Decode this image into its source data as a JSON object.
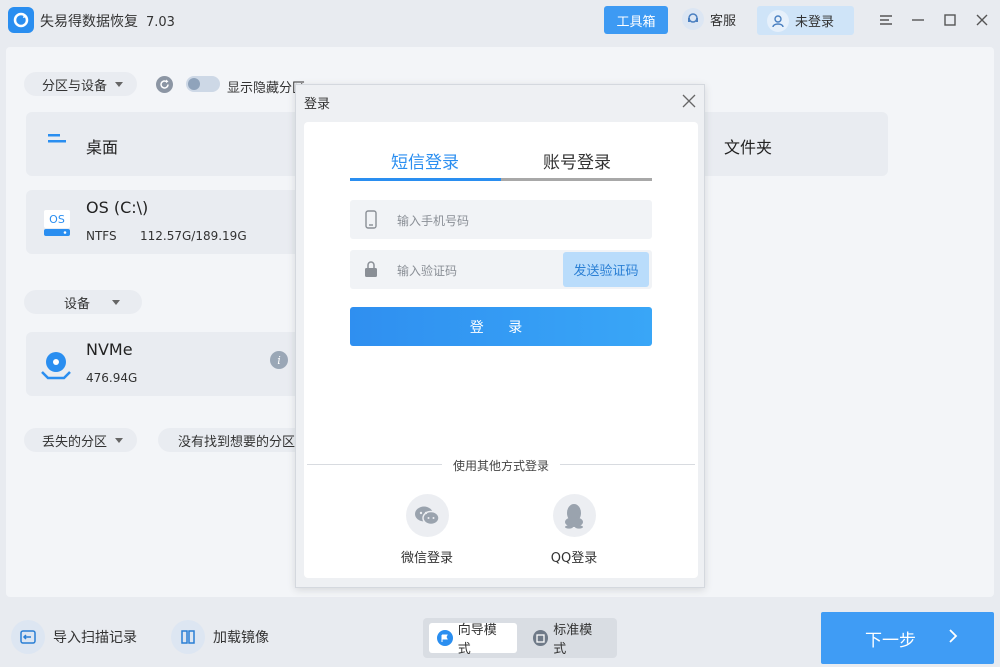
{
  "titlebar": {
    "app_name": "失易得数据恢复",
    "version": "7.03",
    "toolbox_label": "工具箱",
    "service_label": "客服",
    "login_status": "未登录"
  },
  "main": {
    "partition_dropdown": "分区与设备",
    "show_hidden_label": "显示隐藏分区",
    "desktop_label": "桌面",
    "folder_label": "文件夹",
    "os_drive": {
      "badge": "OS",
      "name": "OS (C:\\)",
      "fs": "NTFS",
      "usage": "112.57G/189.19G"
    },
    "device_dropdown": "设备",
    "nvme": {
      "name": "NVMe",
      "size": "476.94G"
    },
    "lost_partition_dropdown": "丢失的分区",
    "not_found_label": "没有找到想要的分区"
  },
  "bottom": {
    "import_scan": "导入扫描记录",
    "load_image": "加载镜像",
    "guide_mode": "向导模式",
    "standard_mode": "标准模式",
    "next_step": "下一步"
  },
  "modal": {
    "title": "登录",
    "tabs": [
      "短信登录",
      "账号登录"
    ],
    "phone_placeholder": "输入手机号码",
    "code_placeholder": "输入验证码",
    "send_code": "发送验证码",
    "login_button": "登 录",
    "other_methods": "使用其他方式登录",
    "wechat_login": "微信登录",
    "qq_login": "QQ登录"
  },
  "colors": {
    "accent": "#3f9cf5",
    "tab_active": "#2a8ef0",
    "tab_inactive_line": "#a8a8a8"
  }
}
